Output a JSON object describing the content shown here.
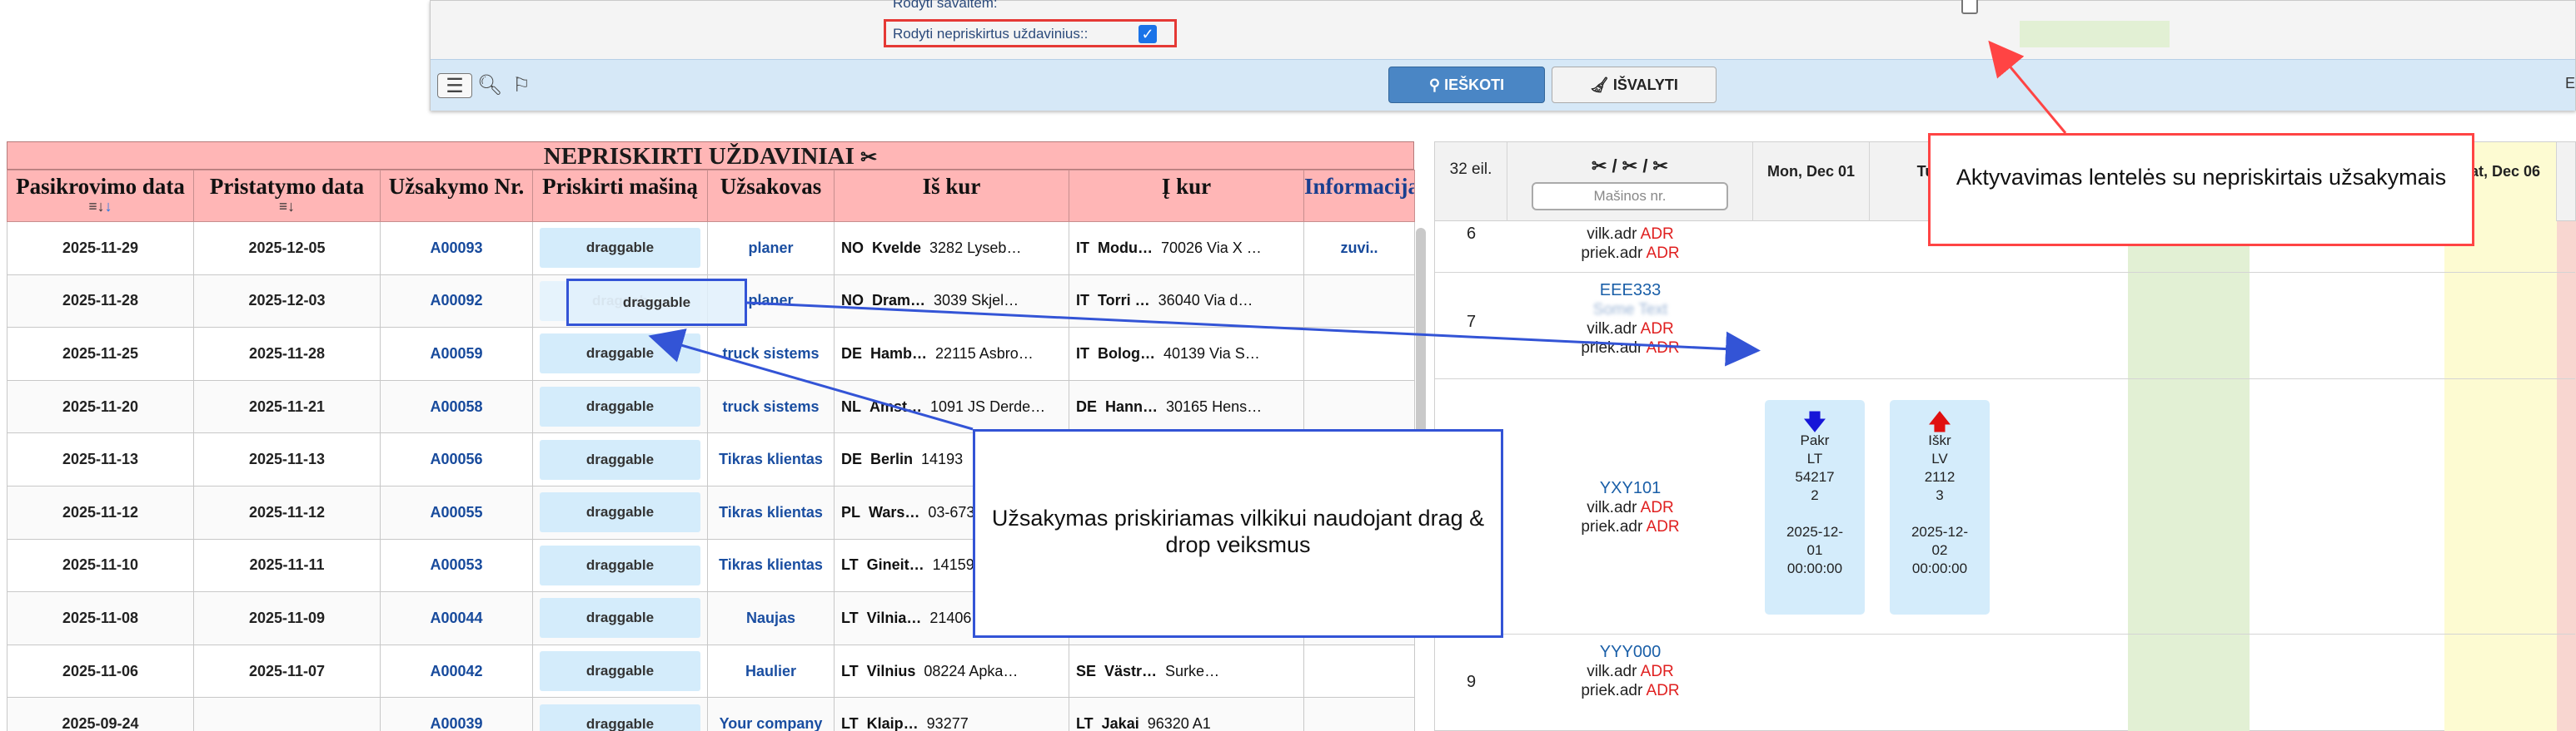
{
  "filter_panel": {
    "show_week_label": "Rodyti savaitem:",
    "show_unassigned_label": "Rodyti nepriskirtus uždavinius::",
    "show_unassigned_checked": true,
    "search_button": "IEŠKOTI",
    "clear_button": "IŠVALYTI",
    "edge_text": "E",
    "icons": [
      "menu-icon",
      "zoom-icon",
      "bookmark-icon"
    ]
  },
  "unassigned": {
    "title": "NEPRISKIRTI UŽDAVINIAI",
    "columns": [
      "Pasikrovimo data",
      "Pristatymo data",
      "Užsakymo Nr.",
      "Priskirti mašiną",
      "Užsakovas",
      "Iš kur",
      "Į kur",
      "Informacija"
    ],
    "sort_hint": "↓",
    "rows": [
      {
        "pickup": "2025-11-29",
        "delivery": "2025-12-05",
        "order": "A00093",
        "assign": "draggable",
        "client": "planer",
        "from_cc": "NO",
        "from_city": "Kvelde",
        "from_addr": "3282 Lyseb…",
        "to_cc": "IT",
        "to_city": "Modu…",
        "to_addr": "70026 Via X …",
        "info": "zuvi.."
      },
      {
        "pickup": "2025-11-28",
        "delivery": "2025-12-03",
        "order": "A00092",
        "assign": "draggable",
        "client": "planer",
        "from_cc": "NO",
        "from_city": "Dram…",
        "from_addr": "3039 Skjel…",
        "to_cc": "IT",
        "to_city": "Torri …",
        "to_addr": "36040 Via d…",
        "info": ""
      },
      {
        "pickup": "2025-11-25",
        "delivery": "2025-11-28",
        "order": "A00059",
        "assign": "draggable",
        "client": "truck sistems",
        "from_cc": "DE",
        "from_city": "Hamb…",
        "from_addr": "22115 Asbro…",
        "to_cc": "IT",
        "to_city": "Bolog…",
        "to_addr": "40139 Via S…",
        "info": ""
      },
      {
        "pickup": "2025-11-20",
        "delivery": "2025-11-21",
        "order": "A00058",
        "assign": "draggable",
        "client": "truck sistems",
        "from_cc": "NL",
        "from_city": "Amst…",
        "from_addr": "1091 JS Derde…",
        "to_cc": "DE",
        "to_city": "Hann…",
        "to_addr": "30165 Hens…",
        "info": ""
      },
      {
        "pickup": "2025-11-13",
        "delivery": "2025-11-13",
        "order": "A00056",
        "assign": "draggable",
        "client": "Tikras klientas",
        "from_cc": "DE",
        "from_city": "Berlin",
        "from_addr": "14193",
        "to_cc": "",
        "to_city": "",
        "to_addr": "",
        "info": ""
      },
      {
        "pickup": "2025-11-12",
        "delivery": "2025-11-12",
        "order": "A00055",
        "assign": "draggable",
        "client": "Tikras klientas",
        "from_cc": "PL",
        "from_city": "Wars…",
        "from_addr": "03-673",
        "to_cc": "",
        "to_city": "",
        "to_addr": "",
        "info": ""
      },
      {
        "pickup": "2025-11-10",
        "delivery": "2025-11-11",
        "order": "A00053",
        "assign": "draggable",
        "client": "Tikras klientas",
        "from_cc": "LT",
        "from_city": "Gineit…",
        "from_addr": "14159",
        "to_cc": "",
        "to_city": "",
        "to_addr": "",
        "info": ""
      },
      {
        "pickup": "2025-11-08",
        "delivery": "2025-11-09",
        "order": "A00044",
        "assign": "draggable",
        "client": "Naujas",
        "from_cc": "LT",
        "from_city": "Vilnia…",
        "from_addr": "21406",
        "to_cc": "",
        "to_city": "",
        "to_addr": "",
        "info": ""
      },
      {
        "pickup": "2025-11-06",
        "delivery": "2025-11-07",
        "order": "A00042",
        "assign": "draggable",
        "client": "Haulier",
        "from_cc": "LT",
        "from_city": "Vilnius",
        "from_addr": "08224 Apka…",
        "to_cc": "SE",
        "to_city": "Västr…",
        "to_addr": "Surke…",
        "info": ""
      },
      {
        "pickup": "2025-09-24",
        "delivery": "",
        "order": "A00039",
        "assign": "draggable",
        "client": "Your company",
        "from_cc": "LT",
        "from_city": "Klaip…",
        "from_addr": "93277",
        "to_cc": "LT",
        "to_city": "Jakai",
        "to_addr": "96320 A1",
        "info": ""
      }
    ],
    "ghost_label": "draggable",
    "ghost_under": "draggab"
  },
  "planner": {
    "count_label": "32 eil.",
    "vehicle_header_icons": "✂ / ✂ / ✂",
    "vehicle_filter_placeholder": "Mašinos nr.",
    "days": [
      "Mon, Dec 01",
      "Tue,",
      "",
      "",
      "",
      "Sat, Dec 06"
    ],
    "rows": [
      {
        "no": "6",
        "vehicle": "",
        "blurred": "",
        "vilk": "vilk.adr",
        "priek": "priek.adr",
        "adr": "ADR"
      },
      {
        "no": "7",
        "vehicle": "EEE333",
        "blurred": "Some Text",
        "vilk": "vilk.adr",
        "priek": "priek.adr",
        "adr": "ADR"
      },
      {
        "no": "",
        "vehicle": "YXY101",
        "blurred": "",
        "vilk": "vilk.adr",
        "priek": "priek.adr",
        "adr": "ADR"
      },
      {
        "no": "9",
        "vehicle": "YYY000",
        "blurred": "",
        "vilk": "vilk.adr",
        "priek": "priek.adr",
        "adr": "ADR"
      }
    ],
    "tasks": [
      {
        "arrow": "🡇",
        "arrow_color": "#1616d8",
        "type": "Pakr",
        "cc": "LT",
        "zip": "54217",
        "n": "2",
        "date": "2025-12-01",
        "time": "00:00:00"
      },
      {
        "arrow": "🡅",
        "arrow_color": "#e01010",
        "type": "Iškr",
        "cc": "LV",
        "zip": "2112",
        "n": "3",
        "date": "2025-12-02",
        "time": "00:00:00"
      }
    ]
  },
  "callouts": {
    "top": "Aktyvavimas lentelės su nepriskirtais užsakymais",
    "mid": "Užsakymas priskiriamas vilkikui naudojant drag & drop veiksmus"
  },
  "colors": {
    "header_pink": "#ffb6b6",
    "drag_blue": "#d4ecfb",
    "callout_red": "#ff4444",
    "callout_blue": "#3354d6",
    "weekend_green": "#e2f0d4",
    "weekend_yellow": "#fdfbd2"
  }
}
